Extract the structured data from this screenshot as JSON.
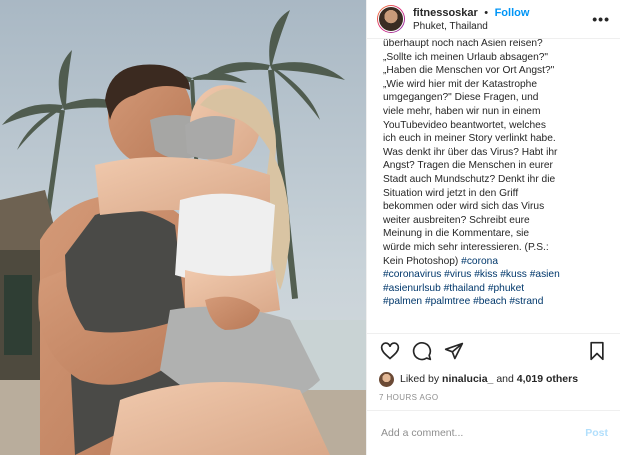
{
  "header": {
    "username": "fitnessoskar",
    "separator": "•",
    "follow_label": "Follow",
    "location": "Phuket, Thailand",
    "more_label": "•••"
  },
  "caption": {
    "lines": [
      "überhaupt noch nach Asien reisen?",
      "„Sollte ich meinen Urlaub absagen?\"",
      "„Haben die Menschen vor Ort Angst?\"",
      "„Wie wird hier mit der Katastrophe",
      "umgegangen?\" Diese Fragen, und",
      "viele mehr, haben wir nun in einem",
      "YouTubevideo beantwortet, welches",
      "ich euch in meiner Story verlinkt habe.",
      "Was denkt ihr über das Virus? Habt ihr",
      "Angst? Tragen die Menschen in eurer",
      "Stadt auch Mundschutz? Denkt ihr die",
      "Situation wird jetzt in den Griff",
      "bekommen oder wird sich das Virus",
      "weiter ausbreiten? Schreibt eure",
      "Meinung in die Kommentare, sie",
      "würde mich sehr interessieren. (P.S.:",
      "Kein Photoshop)"
    ],
    "hashtags": [
      [
        "#corona"
      ],
      [
        "#coronavirus",
        "#virus",
        "#kiss",
        "#kuss",
        "#asien"
      ],
      [
        "#asienurlsub",
        "#thailand",
        "#phuket"
      ],
      [
        "#palmen",
        "#palmtree",
        "#beach",
        "#strand"
      ]
    ]
  },
  "actions": {
    "like_icon": "heart-icon",
    "comment_icon": "comment-icon",
    "share_icon": "share-icon",
    "save_icon": "bookmark-icon"
  },
  "likes": {
    "prefix": "Liked by",
    "user": "ninalucia_",
    "conjunction": "and",
    "count": "4,019 others"
  },
  "timestamp": "7 HOURS AGO",
  "comment": {
    "placeholder": "Add a comment...",
    "post_label": "Post"
  },
  "colors": {
    "link": "#0095f6",
    "hashtag": "#00376b",
    "muted": "#8e8e8e",
    "post_disabled": "#b2dffc"
  }
}
